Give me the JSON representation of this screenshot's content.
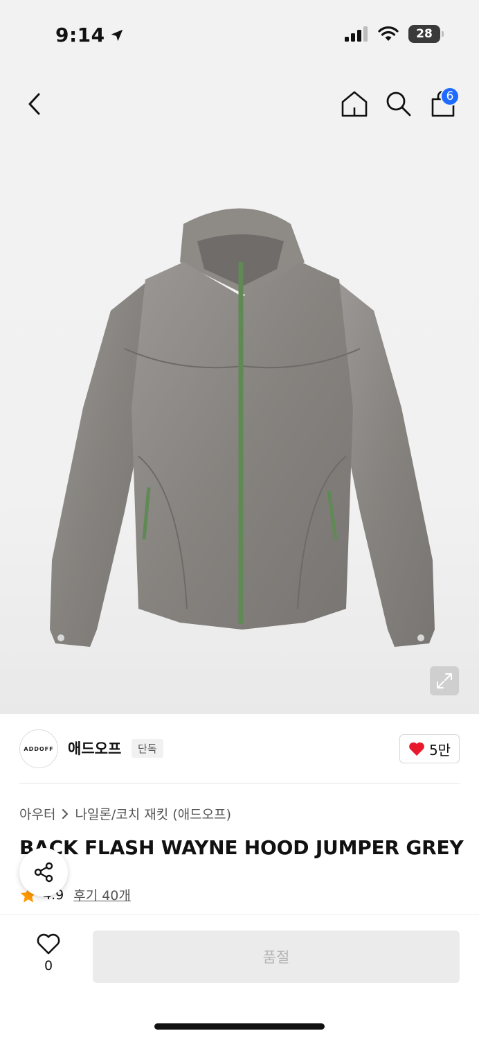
{
  "status_bar": {
    "time": "9:14",
    "battery": "28"
  },
  "header": {
    "cart_count": "6"
  },
  "brand": {
    "logo_text": "ADDOFF",
    "name": "애드오프",
    "tag": "단독",
    "likes": "5만"
  },
  "breadcrumb": {
    "category": "아우터",
    "subcategory": "나일론/코치 재킷 (애드오프)"
  },
  "product": {
    "title": "BACK FLASH WAYNE HOOD JUMPER GREY",
    "rating": "4.9",
    "reviews": "후기 40개"
  },
  "bottom": {
    "wish_count": "0",
    "buy_label": "품절"
  },
  "colors": {
    "accent": "#1f6bff",
    "heart": "#e8192c",
    "star": "#ff9900",
    "jacket": "#8a8784",
    "zipper": "#5f8a55"
  }
}
